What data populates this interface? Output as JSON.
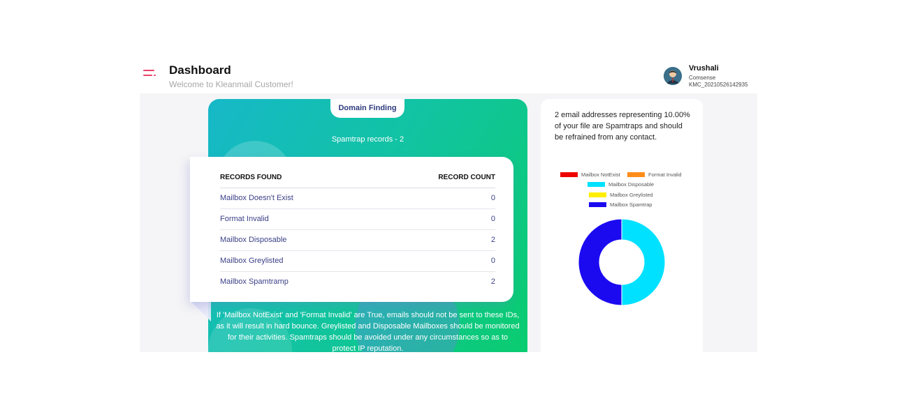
{
  "header": {
    "title": "Dashboard",
    "subtitle": "Welcome to Kleanmail Customer!",
    "user": {
      "name": "Vrushali",
      "company": "Comsense",
      "id": "KMC_20210526142935"
    }
  },
  "domain_card": {
    "tab_label": "Domain Finding",
    "spamtrap_title": "Spamtrap records - 2",
    "table": {
      "headers": [
        "RECORDS FOUND",
        "RECORD COUNT"
      ],
      "rows": [
        {
          "label": "Mailbox Doesn't Exist",
          "count": "0"
        },
        {
          "label": "Format Invalid",
          "count": "0"
        },
        {
          "label": "Mailbox Disposable",
          "count": "2"
        },
        {
          "label": "Mailbox Greylisted",
          "count": "0"
        },
        {
          "label": "Mailbox Spamtramp",
          "count": "2"
        }
      ]
    },
    "note": "If 'Mailbox NotExist' and 'Format Invalid' are True, emails should not be sent to these IDs, as it will result in hard bounce. Greylisted and Disposable Mailboxes should be monitored for their activities. Spamtraps should be avoided under any circumstances so as to protect IP reputation."
  },
  "summary_card": {
    "text": "2 email addresses representing 10.00% of your file are Spamtraps and should be refrained from any contact."
  },
  "chart_data": {
    "type": "pie",
    "categories": [
      "Mailbox NotExist",
      "Format Invalid",
      "Mailbox Disposable",
      "Mailbox Greylisted",
      "Mailbox Spamtrap"
    ],
    "values": [
      0,
      0,
      2,
      0,
      2
    ],
    "colors": [
      "#ee0000",
      "#ff8c1a",
      "#00e1ff",
      "#ffee00",
      "#1b0af0"
    ],
    "legend": "top",
    "donut": true
  },
  "colors": {
    "accent": "#e8446a",
    "table_text": "#3a3f86",
    "gradient_start": "#16b8c8",
    "gradient_end": "#0acc6e"
  },
  "icons": {
    "menu": "hamburger-menu-icon",
    "avatar": "user-avatar"
  }
}
